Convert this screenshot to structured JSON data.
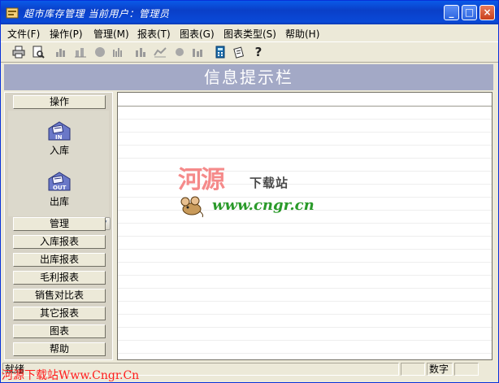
{
  "window": {
    "title": "超市库存管理 当前用户：管理员",
    "controls": {
      "minimize": "_",
      "maximize": "□",
      "close": "×"
    }
  },
  "menu": [
    "文件(F)",
    "操作(P)",
    "管理(M)",
    "报表(T)",
    "图表(G)",
    "图表类型(S)",
    "帮助(H)"
  ],
  "toolbar": {
    "icons": [
      "printer-icon",
      "print-preview-icon",
      "bar-chart-icon",
      "bar-chart-3d-icon",
      "pie-chart-icon",
      "column-chart-icon",
      "grouped-bar-icon",
      "line-chart-icon",
      "pie-3d-icon",
      "stacked-bar-icon",
      "calculator-icon",
      "notepad-icon",
      "help-icon"
    ],
    "help_glyph": "?"
  },
  "banner": {
    "text": "信息提示栏"
  },
  "left_panel": {
    "section_top": "操作",
    "icons": [
      {
        "label": "入库",
        "badge": "IN"
      },
      {
        "label": "出库",
        "badge": "OUT"
      }
    ],
    "scroll_glyph": "▼",
    "buttons": [
      "管理",
      "入库报表",
      "出库报表",
      "毛利报表",
      "销售对比表",
      "其它报表",
      "图表",
      "帮助"
    ]
  },
  "logo": {
    "river_text": "河源",
    "download_text": "下载站",
    "url_text": "www.cngr.cn"
  },
  "status": {
    "ready": "就绪",
    "numlock": "数字"
  },
  "watermark": "河源下载站Www.Cngr.Cn",
  "colors": {
    "titlebar": "#0a4ad8",
    "banner": "#a3a9c6",
    "logo_red": "#f58a8a",
    "logo_green": "#2a9a2a",
    "watermark_red": "#ff1a1a"
  }
}
